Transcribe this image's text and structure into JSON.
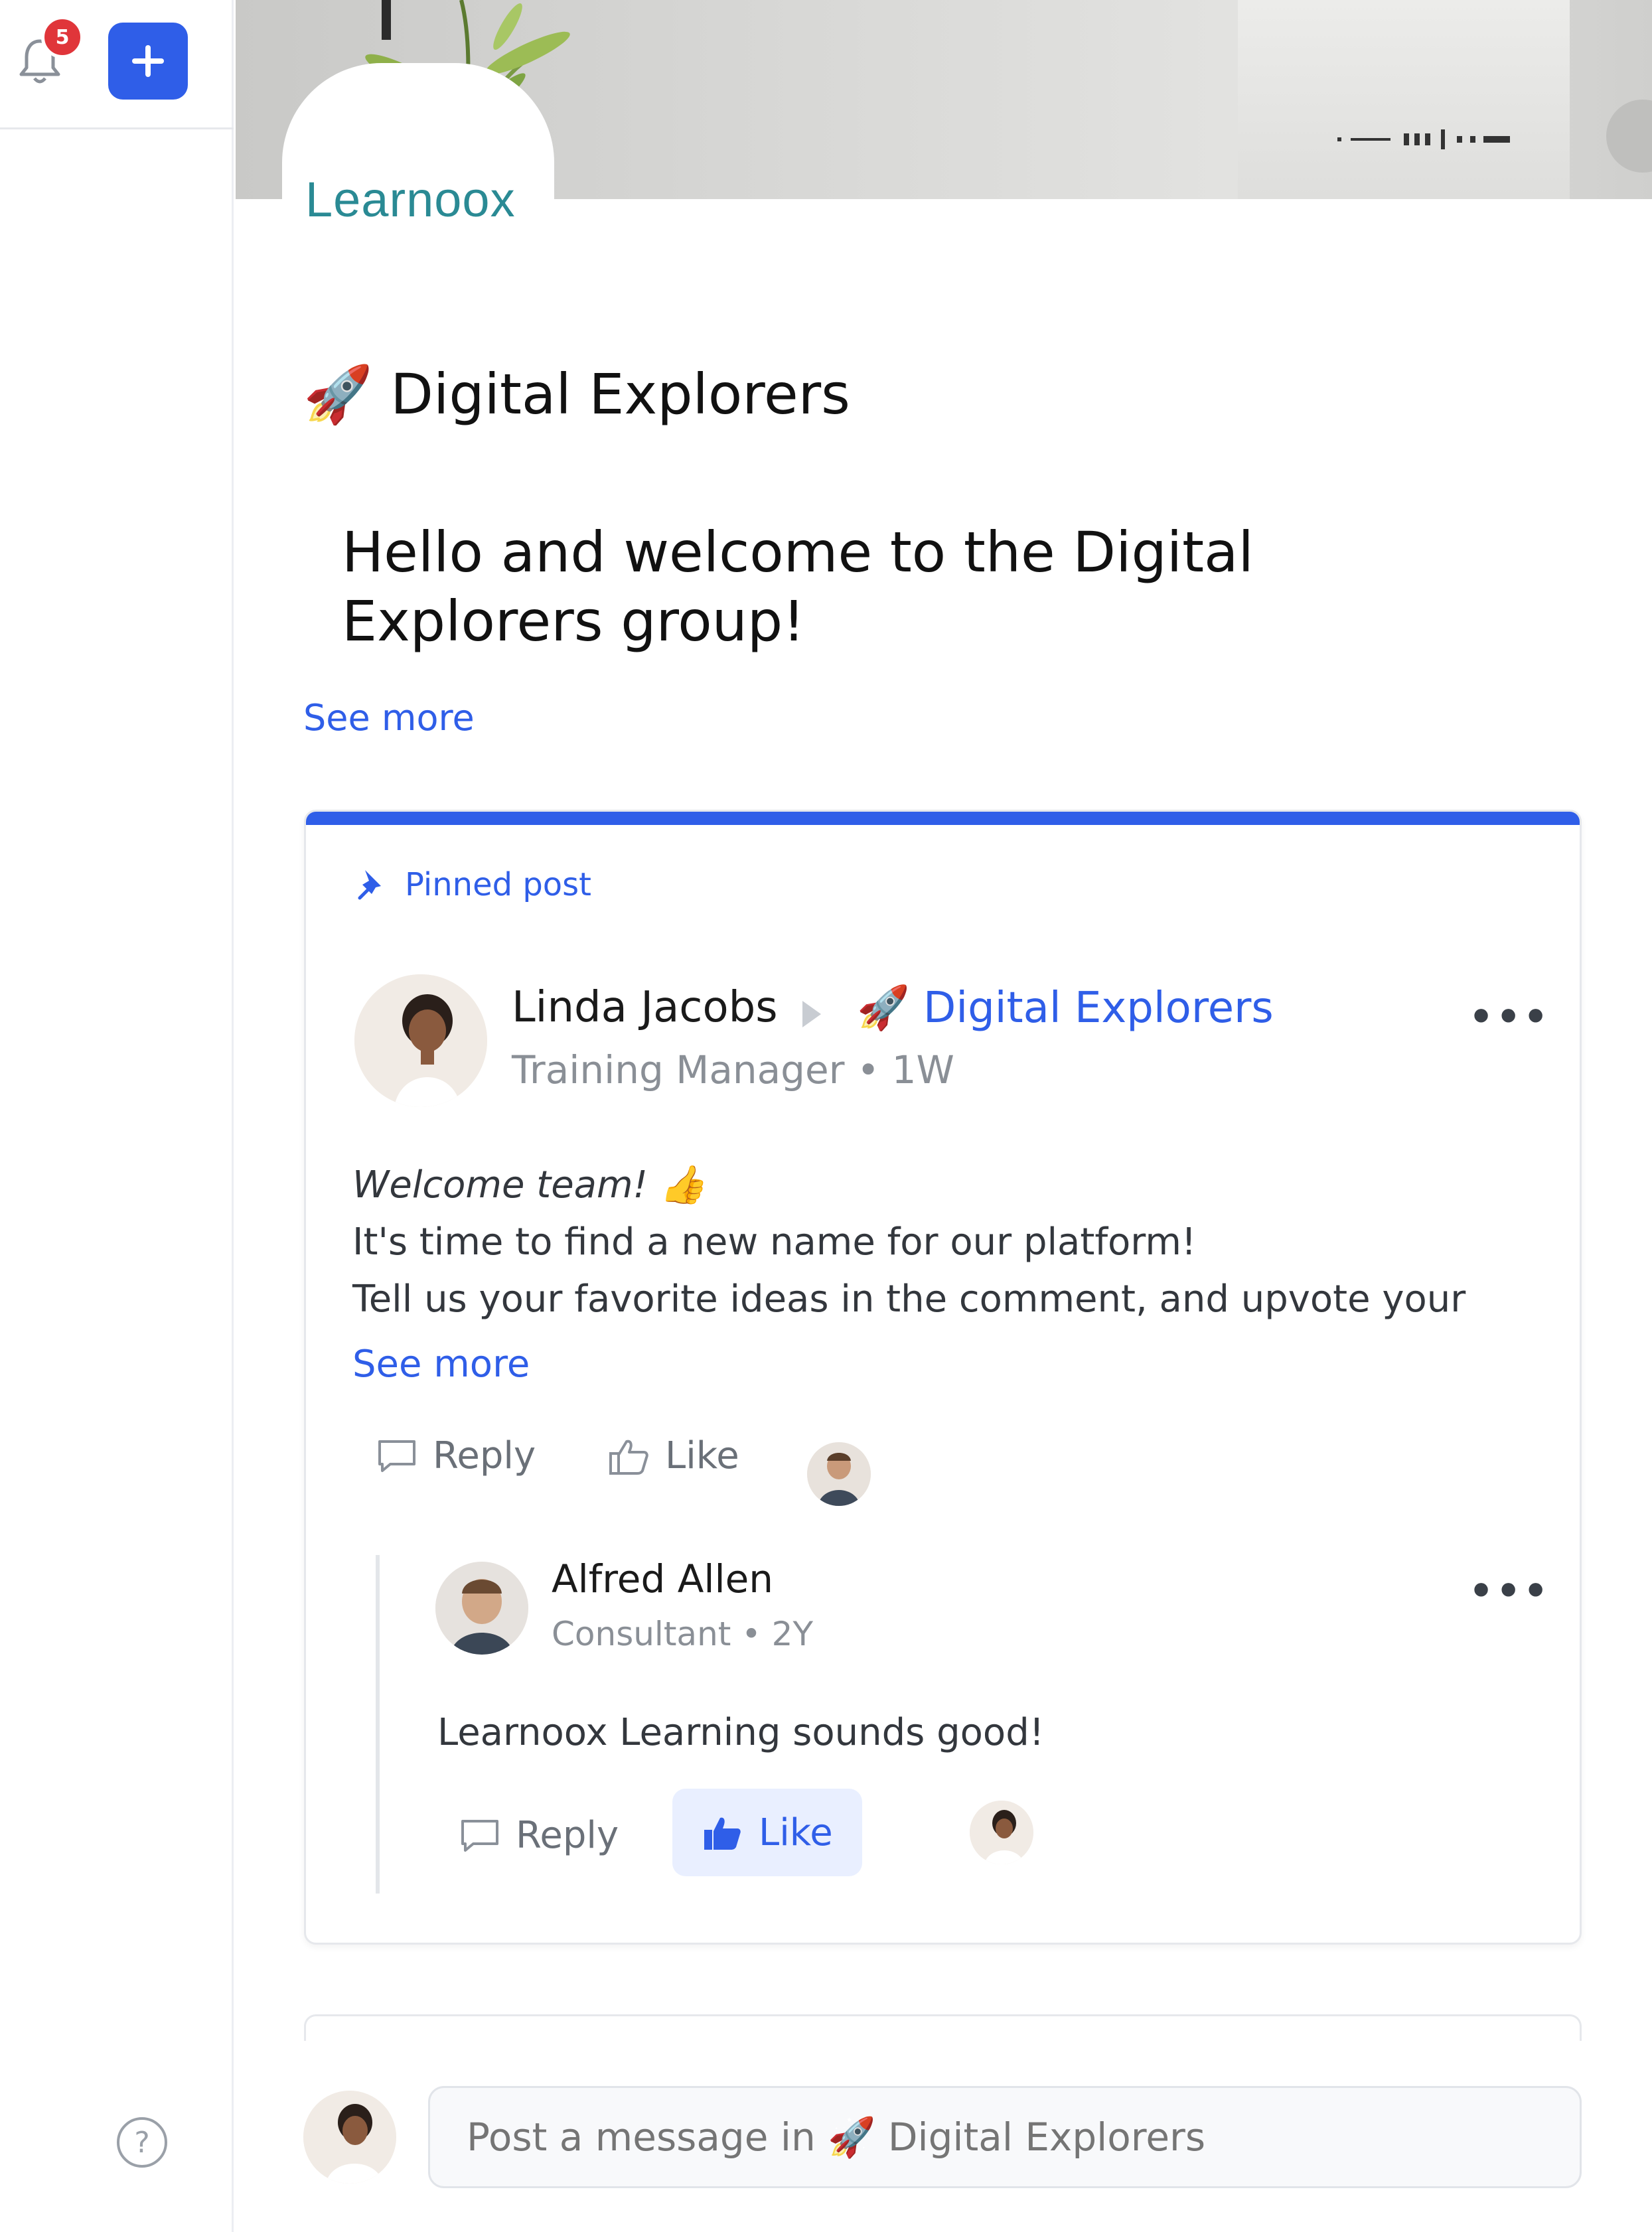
{
  "rail": {
    "notification_count": "5"
  },
  "banner": {
    "logo_text": "Learnoox"
  },
  "group": {
    "emoji": "🚀",
    "title": "Digital Explorers",
    "welcome": "Hello and welcome to the Digital Explorers group!",
    "see_more": "See more"
  },
  "pinned_post": {
    "pinned_label": "Pinned post",
    "author": {
      "name": "Linda Jacobs",
      "group": "🚀 Digital Explorers",
      "role": "Training Manager",
      "time": "1W"
    },
    "body": {
      "line1": "Welcome team! 👍",
      "line2": "It's time to find a new name for our platform!",
      "line3": "Tell us your favorite ideas in the comment, and upvote your"
    },
    "see_more": "See more",
    "actions": {
      "reply": "Reply",
      "like": "Like"
    },
    "reply": {
      "name": "Alfred Allen",
      "role": "Consultant",
      "time": "2Y",
      "text": "Learnoox Learning sounds good!",
      "actions": {
        "reply": "Reply",
        "like": "Like"
      }
    }
  },
  "composer": {
    "placeholder": "Post a message in 🚀 Digital Explorers"
  },
  "colors": {
    "accent": "#2f5ee8",
    "badge": "#e0353a",
    "logo": "#2a8a94"
  }
}
